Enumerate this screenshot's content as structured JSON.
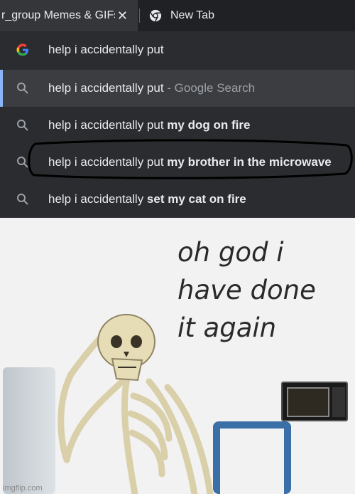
{
  "tabs": [
    {
      "title": "r_group Memes & GIFs",
      "close_glyph": "✕"
    },
    {
      "title": "New Tab"
    }
  ],
  "omnibox": {
    "input_text": "help i accidentally put",
    "suggestions": [
      {
        "prefix": "help i accidentally put",
        "suffix": " - Google Search",
        "bold": ""
      },
      {
        "prefix": "help i accidentally put ",
        "suffix": "",
        "bold": "my dog on fire"
      },
      {
        "prefix": "help i accidentally put ",
        "suffix": "",
        "bold": "my brother in the microwave"
      },
      {
        "prefix": "help i accidentally ",
        "suffix": "",
        "bold": "set my cat on fire"
      }
    ]
  },
  "meme": {
    "caption_lines": [
      "oh god i",
      "have done",
      "it again"
    ],
    "watermark": "imgflip.com"
  },
  "colors": {
    "accent": "#8ab4f8",
    "tab_bg": "#35363a",
    "dropdown_bg": "#2b2c2f",
    "selected_row": "#3c3d41"
  }
}
